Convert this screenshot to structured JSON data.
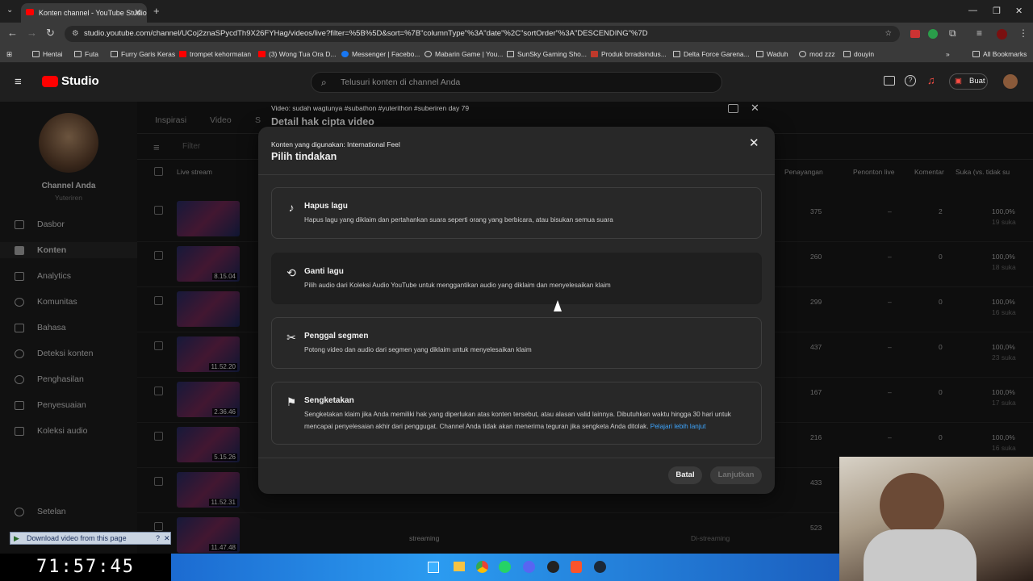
{
  "browser": {
    "tab_title": "Konten channel - YouTube Studio",
    "url": "studio.youtube.com/channel/UCoj2znaSPycdTh9X26FYHag/videos/live?filter=%5B%5D&sort=%7B\"columnType\"%3A\"date\"%2C\"sortOrder\"%3A\"DESCENDING\"%7D",
    "bookmarks": [
      "Hentai",
      "Futa",
      "Furry Garis Keras",
      "trompet kehormatan",
      "(3) Wong Tua Ora D...",
      "Messenger | Facebo...",
      "Mabarin Game | You...",
      "SunSky Gaming Sho...",
      "Produk brradsindus...",
      "Delta Force Garena...",
      "Waduh",
      "mod zzz",
      "douyin"
    ],
    "all_bookmarks": "All Bookmarks"
  },
  "studio": {
    "logo": "Studio",
    "search_placeholder": "Telusuri konten di channel Anda",
    "create_label": "Buat",
    "channel_name": "Channel Anda",
    "channel_handle": "Yuteriren",
    "nav": [
      "Dasbor",
      "Konten",
      "Analytics",
      "Komunitas",
      "Bahasa",
      "Deteksi konten",
      "Penghasilan",
      "Penyesuaian",
      "Koleksi audio"
    ],
    "settings": "Setelan",
    "tabs": [
      "Inspirasi",
      "Video",
      "S"
    ],
    "filter_label": "Filter",
    "col_livestream": "Live stream",
    "columns": [
      "Penayangan",
      "Penonton live",
      "Komentar",
      "Suka (vs. tidak su"
    ],
    "rows": [
      {
        "views": "375",
        "live": "–",
        "comments": "2",
        "likes": "100,0%",
        "likes_count": "19 suka",
        "dur": ""
      },
      {
        "views": "260",
        "live": "–",
        "comments": "0",
        "likes": "100,0%",
        "likes_count": "18 suka",
        "dur": "8.15.04"
      },
      {
        "views": "299",
        "live": "–",
        "comments": "0",
        "likes": "100,0%",
        "likes_count": "16 suka",
        "dur": ""
      },
      {
        "views": "437",
        "live": "–",
        "comments": "0",
        "likes": "100,0%",
        "likes_count": "23 suka",
        "dur": "11.52.20"
      },
      {
        "views": "167",
        "live": "–",
        "comments": "0",
        "likes": "100,0%",
        "likes_count": "17 suka",
        "dur": "2.36.46"
      },
      {
        "views": "216",
        "live": "–",
        "comments": "0",
        "likes": "100,0%",
        "likes_count": "16 suka",
        "dur": "5.15.26"
      },
      {
        "views": "433",
        "live": "",
        "comments": "",
        "likes": "",
        "likes_count": "",
        "dur": "11.52.31"
      },
      {
        "views": "523",
        "live": "",
        "comments": "",
        "likes": "",
        "likes_count": "",
        "dur": "11.47.48"
      }
    ],
    "row_bottom_status": "streaming",
    "row_bottom_status2": "Di-streaming"
  },
  "bg_dialog": {
    "video_line": "Video: sudah wagtunya #subathon #yuterithon #suberiren day 79",
    "title": "Detail hak cipta video"
  },
  "dialog": {
    "content_used": "Konten yang digunakan: International Feel",
    "title": "Pilih tindakan",
    "options": [
      {
        "title": "Hapus lagu",
        "desc": "Hapus lagu yang diklaim dan pertahankan suara seperti orang yang berbicara, atau bisukan semua suara"
      },
      {
        "title": "Ganti lagu",
        "desc": "Pilih audio dari Koleksi Audio YouTube untuk menggantikan audio yang diklaim dan menyelesaikan klaim"
      },
      {
        "title": "Penggal segmen",
        "desc": "Potong video dan audio dari segmen yang diklaim untuk menyelesaikan klaim"
      },
      {
        "title": "Sengketakan",
        "desc": "Sengketakan klaim jika Anda memiliki hak yang diperlukan atas konten tersebut, atau alasan valid lainnya. Dibutuhkan waktu hingga 30 hari untuk mencapai penyelesaian akhir dari penggugat. Channel Anda tidak akan menerima teguran jika sengketa Anda ditolak.",
        "link": "Pelajari lebih lanjut"
      }
    ],
    "cancel": "Batal",
    "continue": "Lanjutkan"
  },
  "overlay": {
    "download_bar": "Download video from this page",
    "timer": "71:57:45"
  },
  "colors": {
    "accent_link": "#3ea6ff",
    "notif": "#ff4e45",
    "brand": "#ff0000"
  }
}
